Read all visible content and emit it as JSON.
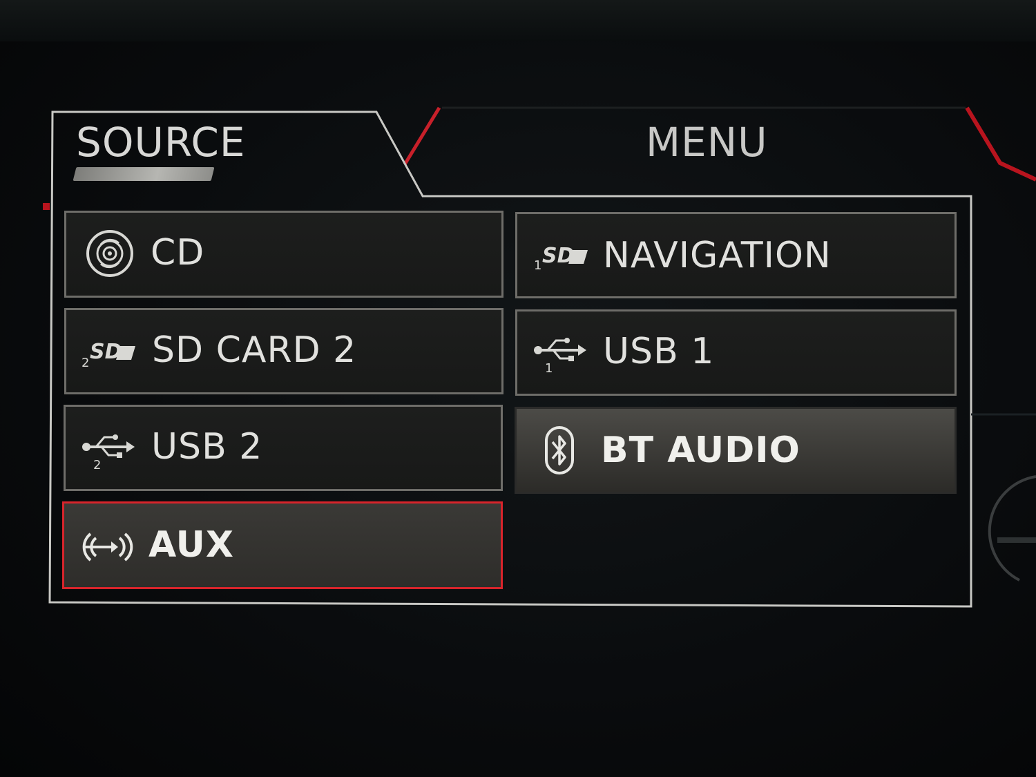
{
  "tabs": {
    "source": "SOURCE",
    "menu": "MENU"
  },
  "sources": [
    {
      "id": "cd",
      "label": "CD",
      "icon": "cd-disc-icon"
    },
    {
      "id": "navigation",
      "label": "NAVIGATION",
      "icon": "sd-card-1-icon",
      "icon_index": "1"
    },
    {
      "id": "sd-card-2",
      "label": "SD CARD 2",
      "icon": "sd-card-2-icon",
      "icon_index": "2"
    },
    {
      "id": "usb-1",
      "label": "USB 1",
      "icon": "usb-1-icon",
      "icon_index": "1"
    },
    {
      "id": "usb-2",
      "label": "USB 2",
      "icon": "usb-2-icon",
      "icon_index": "2"
    },
    {
      "id": "bt-audio",
      "label": "BT AUDIO",
      "icon": "bluetooth-icon"
    },
    {
      "id": "aux",
      "label": "AUX",
      "icon": "aux-signal-icon"
    }
  ],
  "selected": "AUX",
  "highlighted": "BT AUDIO",
  "colors": {
    "accent": "#d8242b",
    "text": "#e1e1de",
    "border": "#6e6d69"
  }
}
